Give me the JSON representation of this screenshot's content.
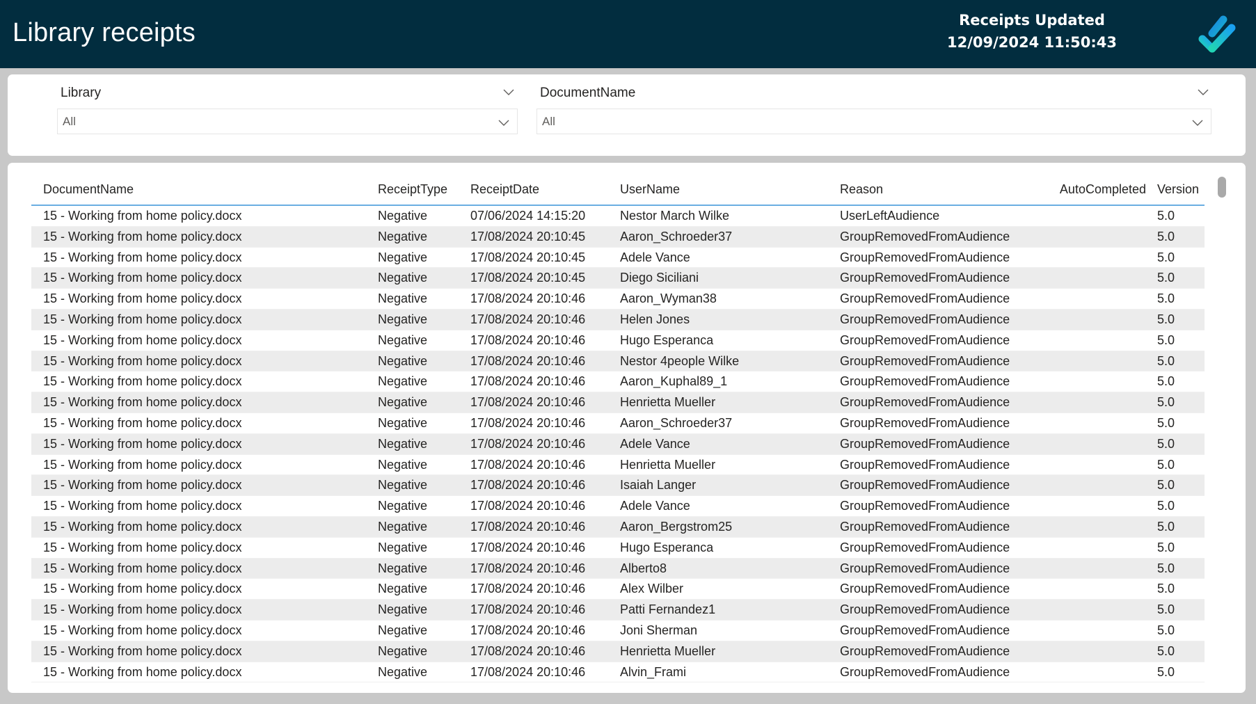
{
  "header": {
    "title": "Library receipts",
    "updated_label": "Receipts Updated",
    "updated_timestamp": "12/09/2024 11:50:43",
    "logo_icon": "checkmark-logo-icon"
  },
  "filters": [
    {
      "label": "Library",
      "value": "All"
    },
    {
      "label": "DocumentName",
      "value": "All"
    }
  ],
  "table": {
    "columns": [
      "DocumentName",
      "ReceiptType",
      "ReceiptDate",
      "UserName",
      "Reason",
      "AutoCompleted",
      "Version"
    ],
    "rows": [
      [
        "15 - Working from home policy.docx",
        "Negative",
        "07/06/2024 14:15:20",
        "Nestor March Wilke",
        "UserLeftAudience",
        "",
        "5.0"
      ],
      [
        "15 - Working from home policy.docx",
        "Negative",
        "17/08/2024 20:10:45",
        "Aaron_Schroeder37",
        "GroupRemovedFromAudience",
        "",
        "5.0"
      ],
      [
        "15 - Working from home policy.docx",
        "Negative",
        "17/08/2024 20:10:45",
        "Adele Vance",
        "GroupRemovedFromAudience",
        "",
        "5.0"
      ],
      [
        "15 - Working from home policy.docx",
        "Negative",
        "17/08/2024 20:10:45",
        "Diego Siciliani",
        "GroupRemovedFromAudience",
        "",
        "5.0"
      ],
      [
        "15 - Working from home policy.docx",
        "Negative",
        "17/08/2024 20:10:46",
        "Aaron_Wyman38",
        "GroupRemovedFromAudience",
        "",
        "5.0"
      ],
      [
        "15 - Working from home policy.docx",
        "Negative",
        "17/08/2024 20:10:46",
        "Helen Jones",
        "GroupRemovedFromAudience",
        "",
        "5.0"
      ],
      [
        "15 - Working from home policy.docx",
        "Negative",
        "17/08/2024 20:10:46",
        "Hugo Esperanca",
        "GroupRemovedFromAudience",
        "",
        "5.0"
      ],
      [
        "15 - Working from home policy.docx",
        "Negative",
        "17/08/2024 20:10:46",
        "Nestor 4people Wilke",
        "GroupRemovedFromAudience",
        "",
        "5.0"
      ],
      [
        "15 - Working from home policy.docx",
        "Negative",
        "17/08/2024 20:10:46",
        "Aaron_Kuphal89_1",
        "GroupRemovedFromAudience",
        "",
        "5.0"
      ],
      [
        "15 - Working from home policy.docx",
        "Negative",
        "17/08/2024 20:10:46",
        "Henrietta Mueller",
        "GroupRemovedFromAudience",
        "",
        "5.0"
      ],
      [
        "15 - Working from home policy.docx",
        "Negative",
        "17/08/2024 20:10:46",
        "Aaron_Schroeder37",
        "GroupRemovedFromAudience",
        "",
        "5.0"
      ],
      [
        "15 - Working from home policy.docx",
        "Negative",
        "17/08/2024 20:10:46",
        "Adele Vance",
        "GroupRemovedFromAudience",
        "",
        "5.0"
      ],
      [
        "15 - Working from home policy.docx",
        "Negative",
        "17/08/2024 20:10:46",
        "Henrietta Mueller",
        "GroupRemovedFromAudience",
        "",
        "5.0"
      ],
      [
        "15 - Working from home policy.docx",
        "Negative",
        "17/08/2024 20:10:46",
        "Isaiah Langer",
        "GroupRemovedFromAudience",
        "",
        "5.0"
      ],
      [
        "15 - Working from home policy.docx",
        "Negative",
        "17/08/2024 20:10:46",
        "Adele Vance",
        "GroupRemovedFromAudience",
        "",
        "5.0"
      ],
      [
        "15 - Working from home policy.docx",
        "Negative",
        "17/08/2024 20:10:46",
        "Aaron_Bergstrom25",
        "GroupRemovedFromAudience",
        "",
        "5.0"
      ],
      [
        "15 - Working from home policy.docx",
        "Negative",
        "17/08/2024 20:10:46",
        "Hugo Esperanca",
        "GroupRemovedFromAudience",
        "",
        "5.0"
      ],
      [
        "15 - Working from home policy.docx",
        "Negative",
        "17/08/2024 20:10:46",
        "Alberto8",
        "GroupRemovedFromAudience",
        "",
        "5.0"
      ],
      [
        "15 - Working from home policy.docx",
        "Negative",
        "17/08/2024 20:10:46",
        "Alex Wilber",
        "GroupRemovedFromAudience",
        "",
        "5.0"
      ],
      [
        "15 - Working from home policy.docx",
        "Negative",
        "17/08/2024 20:10:46",
        "Patti Fernandez1",
        "GroupRemovedFromAudience",
        "",
        "5.0"
      ],
      [
        "15 - Working from home policy.docx",
        "Negative",
        "17/08/2024 20:10:46",
        "Joni Sherman",
        "GroupRemovedFromAudience",
        "",
        "5.0"
      ],
      [
        "15 - Working from home policy.docx",
        "Negative",
        "17/08/2024 20:10:46",
        "Henrietta Mueller",
        "GroupRemovedFromAudience",
        "",
        "5.0"
      ],
      [
        "15 - Working from home policy.docx",
        "Negative",
        "17/08/2024 20:10:46",
        "Alvin_Frami",
        "GroupRemovedFromAudience",
        "",
        "5.0"
      ]
    ]
  },
  "colors": {
    "header_bg": "#022d3f",
    "header_underline": "#6aaee2",
    "alt_row": "#ececec",
    "page_bg": "#c8c8c8"
  }
}
